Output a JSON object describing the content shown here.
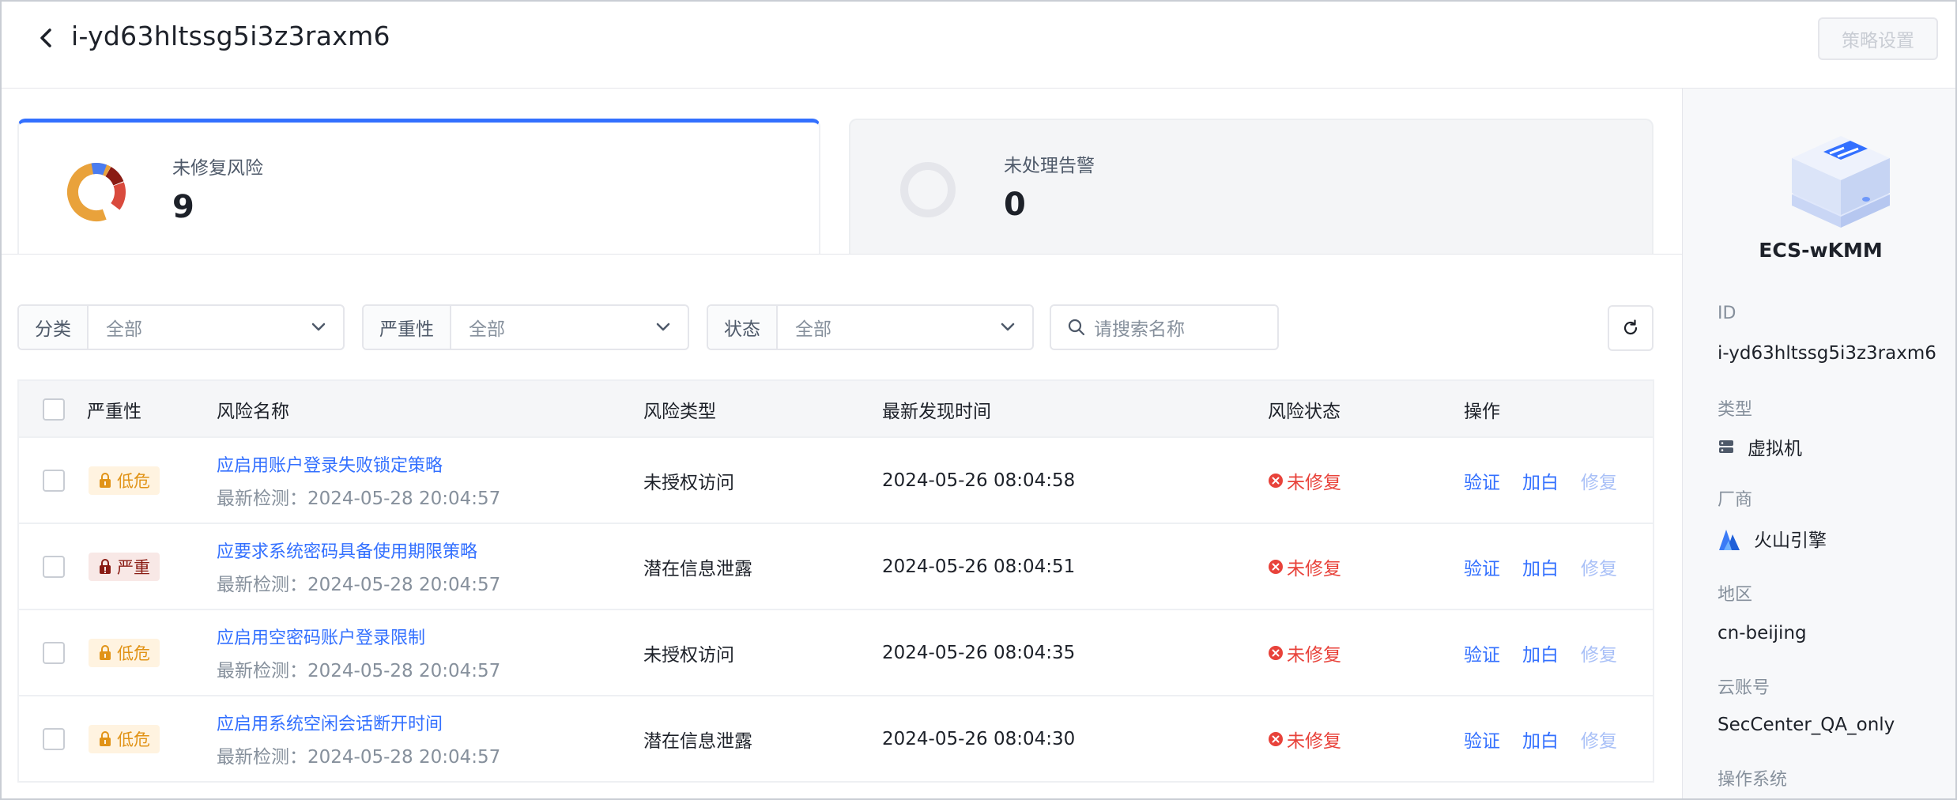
{
  "header": {
    "title": "i-yd63hltssg5i3z3raxm6",
    "policy_button": "策略设置"
  },
  "summary": {
    "risk_label": "未修复风险",
    "risk_count": "9",
    "alert_label": "未处理告警",
    "alert_count": "0"
  },
  "filters": {
    "category": {
      "label": "分类",
      "value": "全部"
    },
    "severity": {
      "label": "严重性",
      "value": "全部"
    },
    "status": {
      "label": "状态",
      "value": "全部"
    },
    "search_placeholder": "请搜索名称"
  },
  "table": {
    "columns": {
      "severity": "严重性",
      "name": "风险名称",
      "type": "风险类型",
      "time": "最新发现时间",
      "status": "风险状态",
      "ops": "操作"
    },
    "rows": [
      {
        "severity": "低危",
        "severity_level": "low",
        "name": "应启用账户登录失败锁定策略",
        "last_check": "最新检测：2024-05-28 20:04:57",
        "type": "未授权访问",
        "time": "2024-05-26 08:04:58",
        "status": "未修复",
        "op_verify": "验证",
        "op_whitelist": "加白",
        "op_fix": "修复"
      },
      {
        "severity": "严重",
        "severity_level": "critical",
        "name": "应要求系统密码具备使用期限策略",
        "last_check": "最新检测：2024-05-28 20:04:57",
        "type": "潜在信息泄露",
        "time": "2024-05-26 08:04:51",
        "status": "未修复",
        "op_verify": "验证",
        "op_whitelist": "加白",
        "op_fix": "修复"
      },
      {
        "severity": "低危",
        "severity_level": "low",
        "name": "应启用空密码账户登录限制",
        "last_check": "最新检测：2024-05-28 20:04:57",
        "type": "未授权访问",
        "time": "2024-05-26 08:04:35",
        "status": "未修复",
        "op_verify": "验证",
        "op_whitelist": "加白",
        "op_fix": "修复"
      },
      {
        "severity": "低危",
        "severity_level": "low",
        "name": "应启用系统空闲会话断开时间",
        "last_check": "最新检测：2024-05-28 20:04:57",
        "type": "潜在信息泄露",
        "time": "2024-05-26 08:04:30",
        "status": "未修复",
        "op_verify": "验证",
        "op_whitelist": "加白",
        "op_fix": "修复"
      }
    ]
  },
  "side": {
    "asset_name": "ECS-wKMM",
    "id_label": "ID",
    "id_value": "i-yd63hltssg5i3z3raxm6",
    "type_label": "类型",
    "type_value": "虚拟机",
    "vendor_label": "厂商",
    "vendor_value": "火山引擎",
    "region_label": "地区",
    "region_value": "cn-beijing",
    "account_label": "云账号",
    "account_value": "SecCenter_QA_only",
    "os_label": "操作系统"
  },
  "colors": {
    "accent": "#3370ff",
    "danger": "#e8423a",
    "low_risk": "#e19317",
    "critical_risk": "#8a1c14"
  }
}
